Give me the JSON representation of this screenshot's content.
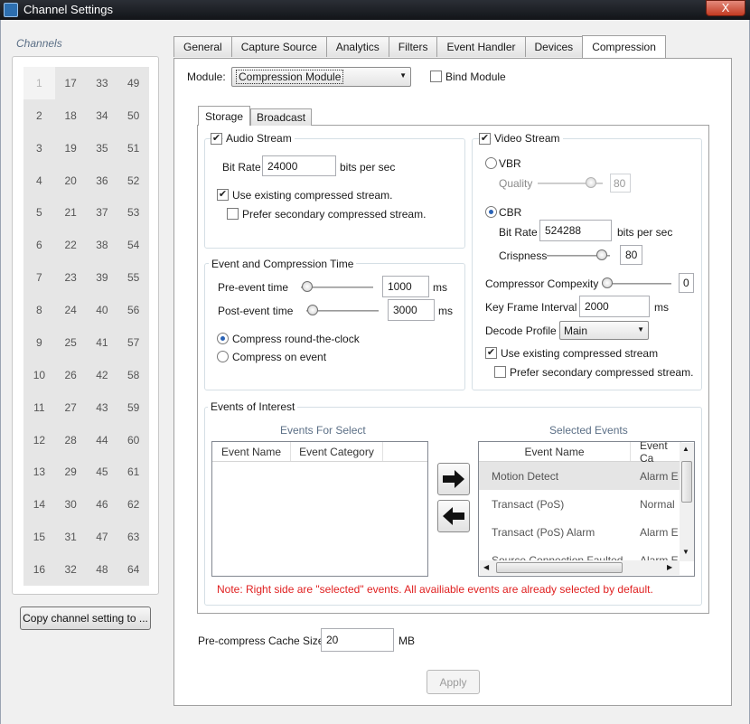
{
  "window": {
    "title": "Channel Settings",
    "close_label": "X"
  },
  "channels": {
    "label": "Channels",
    "numbers": [
      "1",
      "17",
      "33",
      "49",
      "2",
      "18",
      "34",
      "50",
      "3",
      "19",
      "35",
      "51",
      "4",
      "20",
      "36",
      "52",
      "5",
      "21",
      "37",
      "53",
      "6",
      "22",
      "38",
      "54",
      "7",
      "23",
      "39",
      "55",
      "8",
      "24",
      "40",
      "56",
      "9",
      "25",
      "41",
      "57",
      "10",
      "26",
      "42",
      "58",
      "11",
      "27",
      "43",
      "59",
      "12",
      "28",
      "44",
      "60",
      "13",
      "29",
      "45",
      "61",
      "14",
      "30",
      "46",
      "62",
      "15",
      "31",
      "47",
      "63",
      "16",
      "32",
      "48",
      "64"
    ],
    "copy_button": "Copy channel setting to ..."
  },
  "tabs": [
    "General",
    "Capture Source",
    "Analytics",
    "Filters",
    "Event Handler",
    "Devices",
    "Compression"
  ],
  "active_tab": "Compression",
  "module": {
    "label": "Module:",
    "value": "Compression Module",
    "bind_label": "Bind Module",
    "bind_checked": false
  },
  "subtabs": [
    "Storage",
    "Broadcast"
  ],
  "audio": {
    "title": "Audio Stream",
    "checked": true,
    "bitrate_label": "Bit Rate",
    "bitrate_value": "24000",
    "bitrate_unit": "bits per sec",
    "use_existing": "Use existing compressed stream.",
    "use_existing_checked": true,
    "prefer_secondary": "Prefer secondary compressed stream.",
    "prefer_secondary_checked": false
  },
  "event_time": {
    "title": "Event and Compression Time",
    "pre_label": "Pre-event time",
    "pre_value": "1000",
    "pre_unit": "ms",
    "post_label": "Post-event time",
    "post_value": "3000",
    "post_unit": "ms",
    "radio1": "Compress round-the-clock",
    "radio2": "Compress on event",
    "selected": "Compress round-the-clock"
  },
  "video": {
    "title": "Video Stream",
    "checked": true,
    "vbr_label": "VBR",
    "quality_label": "Quality",
    "quality_value": "80",
    "cbr_label": "CBR",
    "cbr_selected": true,
    "bitrate_label": "Bit Rate",
    "bitrate_value": "524288",
    "bitrate_unit": "bits per sec",
    "crispness_label": "Crispness",
    "crispness_value": "80",
    "complexity_label": "Compressor Compexity",
    "complexity_value": "0",
    "keyframe_label": "Key Frame Interval",
    "keyframe_value": "2000",
    "keyframe_unit": "ms",
    "decode_label": "Decode Profile",
    "decode_value": "Main",
    "use_existing": "Use existing compressed stream",
    "use_existing_checked": true,
    "prefer_secondary": "Prefer secondary compressed stream.",
    "prefer_secondary_checked": false
  },
  "events": {
    "title": "Events of Interest",
    "select_title": "Events For Select",
    "selected_title": "Selected Events",
    "columns": [
      "Event Name",
      "Event Category"
    ],
    "selected_columns": [
      "Event Name",
      "Event Ca"
    ],
    "selected_rows": [
      {
        "name": "Motion Detect",
        "category": "Alarm E"
      },
      {
        "name": "Transact (PoS)",
        "category": "Normal"
      },
      {
        "name": "Transact (PoS) Alarm",
        "category": "Alarm E"
      },
      {
        "name": "Source Connection Faulted",
        "category": "Alarm E"
      }
    ],
    "note": "Note: Right side are \"selected\" events. All availiable events are already selected by default."
  },
  "cache": {
    "label": "Pre-compress Cache Size",
    "value": "20",
    "unit": "MB"
  },
  "apply_button": "Apply"
}
